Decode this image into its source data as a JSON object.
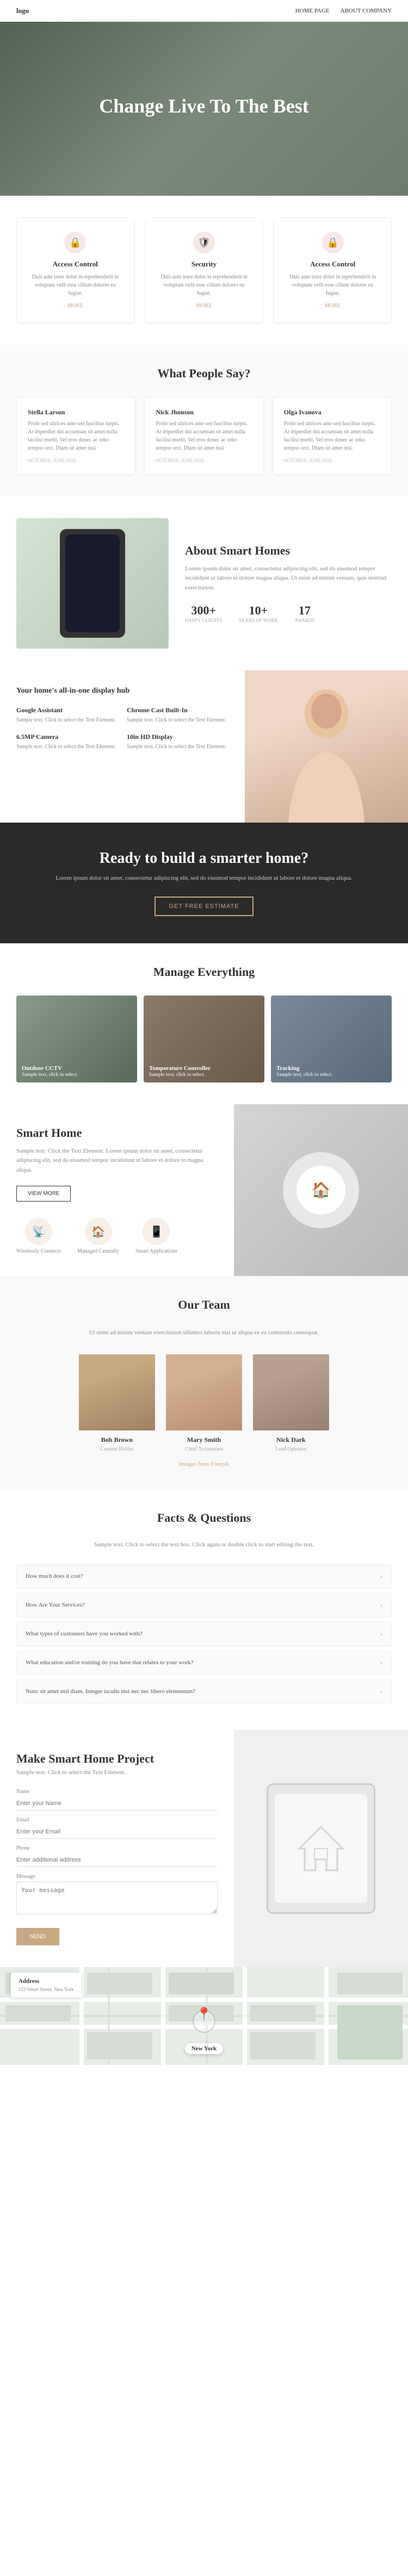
{
  "nav": {
    "logo": "logo",
    "links": [
      "Home Page",
      "About Company"
    ]
  },
  "hero": {
    "title": "Change Live To The Best"
  },
  "features": {
    "title": "",
    "cards": [
      {
        "icon": "🔒",
        "title": "Access Control",
        "desc": "Duis aute irure dolor in reprehenderit in voluptate velit esse cillum dolores eu fugiat.",
        "more": "MORE"
      },
      {
        "icon": "🛡",
        "title": "Security",
        "desc": "Duis aute irure dolor in reprehenderit in voluptate velit esse cillum dolores eu fugiat.",
        "more": "MORE"
      },
      {
        "icon": "🔒",
        "title": "Access Control",
        "desc": "Duis aute irure dolor in reprehenderit in voluptate velit esse cillum dolores eu fugiat.",
        "more": "MORE"
      }
    ]
  },
  "testimonials": {
    "section_title": "What People Say?",
    "cards": [
      {
        "name": "Stella Larson",
        "text": "Proin sed ultrices ante sed faucibus turpis. At imperdiet dui accumsan sit amet nulla facilisi morbi. Vel eros donec ac odio tempor orci. Diam sit amet nisl.",
        "date": "OCTOBER, JUNE 2020"
      },
      {
        "name": "Nick Jhonson",
        "text": "Proin sed ultrices ante sed faucibus turpis. At imperdiet dui accumsan sit amet nulla facilisi morbi. Vel eros donec ac odio tempor orci. Diam sit amet nisl.",
        "date": "OCTOBER, JUNE 2020"
      },
      {
        "name": "Olga Ivanova",
        "text": "Proin sed ultrices ante sed faucibus turpis. At imperdiet dui accumsan sit amet nulla facilisi morbi. Vel eros donec ac odio tempor orci. Diam sit amet nisl.",
        "date": "OCTOBER, JUNE 2020"
      }
    ]
  },
  "about": {
    "title": "About Smart Homes",
    "text": "Lorem ipsum dolor sit amet, consectetur adipiscing elit, sed do eiusmod tempor incididunt ut labore et dolore magna aliqua. Ut enim ad minim veniam, quis nostrud exercitation.",
    "stats": [
      {
        "num": "300+",
        "label": "HAPPY CLIENTS"
      },
      {
        "num": "10+",
        "label": "YEARS OF WORK"
      },
      {
        "num": "17",
        "label": "AWARDS"
      }
    ]
  },
  "hub": {
    "title": "Your home's all-in-one display hub",
    "items": [
      {
        "title": "Google Assistant",
        "text": "Sample text. Click to select the Text Element."
      },
      {
        "title": "Chrome Cast Built-In",
        "text": "Sample text. Click to select the Text Element."
      },
      {
        "title": "6.5MP Camera",
        "text": "Sample text. Click to select the Text Element."
      },
      {
        "title": "10in HD Display",
        "text": "Sample text. Click to select the Text Element."
      }
    ]
  },
  "cta": {
    "title": "Ready to build a smarter home?",
    "text": "Lorem ipsum dolor sit amet, consectetur adipiscing elit, sed do eiusmod tempor incididunt ut labore et dolore magna aliqua.",
    "button": "GET FREE ESTIMATE"
  },
  "manage": {
    "section_title": "Manage Everything",
    "cards": [
      {
        "label": "Outdoor CCTV",
        "sub": "Sample text, click to select."
      },
      {
        "label": "Temperature Controller",
        "sub": "Sample text, click to select."
      },
      {
        "label": "Tracking",
        "sub": "Sample text, click to select."
      }
    ]
  },
  "smart": {
    "title": "Smart Home",
    "text": "Sample text. Click the Text Element. Lorem ipsum dolor sit amet, consectetur adipiscing elit, sed do eiusmod tempor incididunt ut labore et dolore in magna aliqua.",
    "button": "VIEW MORE",
    "icons": [
      {
        "icon": "📡",
        "label": "Wirelessly Connects"
      },
      {
        "icon": "🏠",
        "label": "Managed Centrally"
      },
      {
        "icon": "📱",
        "label": "Smart Applications"
      }
    ]
  },
  "team": {
    "section_title": "Our Team",
    "subtitle": "Ut enim ad minim veniam exercitation ullamco laboris nisi ut aliqua\nex ea commodo consequat.",
    "members": [
      {
        "name": "Bob Brown",
        "role": "Content Holder"
      },
      {
        "name": "Mary Smith",
        "role": "Chief Accountant"
      },
      {
        "name": "Nick Dark",
        "role": "Lead Operator"
      }
    ],
    "more_link": "Images from Freepik"
  },
  "faq": {
    "section_title": "Facts & Questions",
    "subtitle": "Sample text. Click to select the text box. Click again or double click to start editing the text.",
    "items": [
      {
        "question": "How much does it cost?"
      },
      {
        "question": "How Are Your Services?"
      },
      {
        "question": "What types of customers have you worked with?"
      },
      {
        "question": "What education and/or training do you have that relates to your work?"
      },
      {
        "question": "Nunc sit amet nisl diam. Integer iaculis nisi nec nec libero elementum?"
      }
    ]
  },
  "project": {
    "title": "Make Smart Home Project",
    "subtitle": "Sample text. Click to select the Text Element.",
    "form": {
      "name_label": "Name",
      "name_placeholder": "Enter your Name",
      "email_label": "Email",
      "email_placeholder": "Enter your Email",
      "phone_label": "Phone",
      "phone_placeholder": "Enter additional address",
      "message_label": "Message",
      "message_placeholder": "Your message",
      "submit": "SEND"
    }
  },
  "map": {
    "city_label": "New York",
    "mini_card_title": "Address",
    "mini_card_addr": "123 Smart Street, New York"
  }
}
